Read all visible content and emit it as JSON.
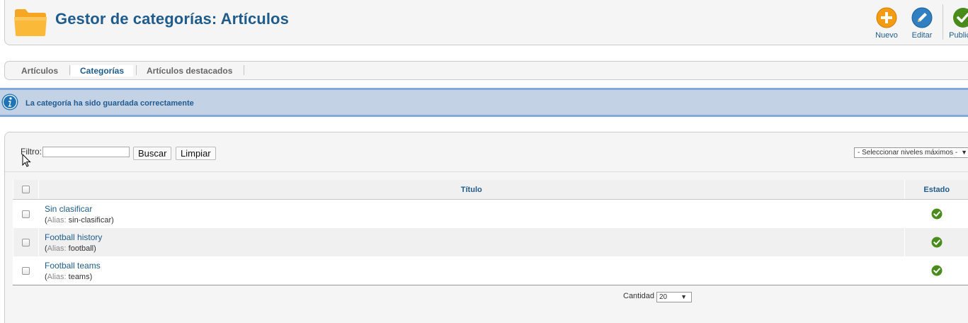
{
  "header": {
    "title": "Gestor de categorías: Artículos",
    "icon": "folder-icon",
    "toolbar": [
      {
        "label": "Nuevo",
        "icon": "add-icon",
        "color": "#f39c12"
      },
      {
        "label": "Editar",
        "icon": "edit-icon",
        "color": "#2f7fc1"
      },
      {
        "label": "Publicar",
        "icon": "publish-icon",
        "color": "#4a8c1c"
      }
    ]
  },
  "tabs": [
    {
      "label": "Artículos",
      "active": false
    },
    {
      "label": "Categorías",
      "active": true
    },
    {
      "label": "Artículos destacados",
      "active": false
    }
  ],
  "message": {
    "text": "La categoría ha sido guardada correctamente",
    "icon": "info-icon"
  },
  "filter": {
    "label": "Filtro:",
    "value": "",
    "search_label": "Buscar",
    "clear_label": "Limpiar",
    "levels_select": "- Seleccionar niveles máximos -"
  },
  "table": {
    "columns": [
      "Título",
      "Estado"
    ],
    "rows": [
      {
        "title": "Sin clasificar",
        "alias_label": "Alias:",
        "alias": "sin-clasificar",
        "state": "published"
      },
      {
        "title": "Football history",
        "alias_label": "Alias:",
        "alias": "football",
        "state": "published"
      },
      {
        "title": "Football teams",
        "alias_label": "Alias:",
        "alias": "teams",
        "state": "published"
      }
    ]
  },
  "pagination": {
    "label": "Cantidad",
    "value": "20"
  },
  "colors": {
    "title_blue": "#1f5c8b",
    "message_bg": "#c3d2e5",
    "published_green": "#4a8c1c"
  }
}
